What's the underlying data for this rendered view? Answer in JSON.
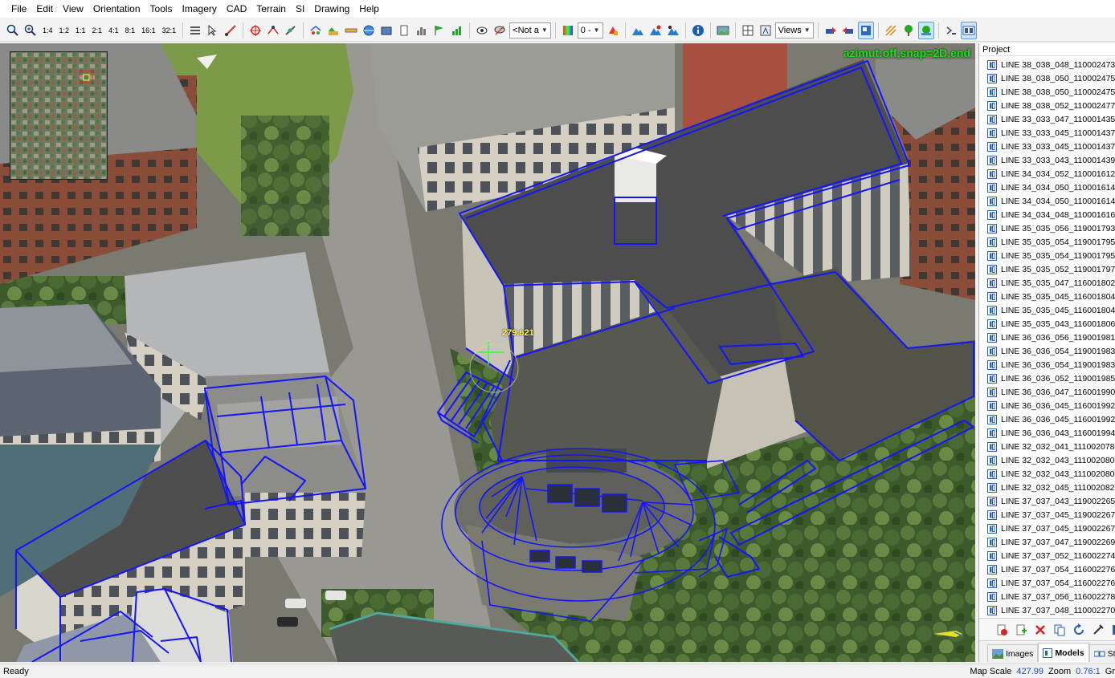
{
  "menu": [
    "File",
    "Edit",
    "View",
    "Orientation",
    "Tools",
    "Imagery",
    "CAD",
    "Terrain",
    "SI",
    "Drawing",
    "Help"
  ],
  "toolbar": {
    "zoom_levels": [
      "1:4",
      "1:2",
      "1:1",
      "2:1",
      "4:1",
      "8:1",
      "16:1",
      "32:1"
    ],
    "combo_not": "<Not a",
    "combo_zero": "0 -",
    "combo_views": "Views"
  },
  "viewport": {
    "overlay_status": "azimut:off,snap=2D,end",
    "height_label": "279.621"
  },
  "project": {
    "title": "Project",
    "items": [
      "LINE 38_038_048_110002473-",
      "LINE 38_038_050_110002475-",
      "LINE 38_038_050_110002475-",
      "LINE 38_038_052_110002477-",
      "LINE 33_033_047_110001435-",
      "LINE 33_033_045_110001437-",
      "LINE 33_033_045_110001437-",
      "LINE 33_033_043_110001439-",
      "LINE 34_034_052_110001612-",
      "LINE 34_034_050_110001614-",
      "LINE 34_034_050_110001614-",
      "LINE 34_034_048_110001616-",
      "LINE 35_035_056_119001793-",
      "LINE 35_035_054_119001795-",
      "LINE 35_035_054_119001795-",
      "LINE 35_035_052_119001797-",
      "LINE 35_035_047_116001802-",
      "LINE 35_035_045_116001804-",
      "LINE 35_035_045_116001804-",
      "LINE 35_035_043_116001806-",
      "LINE 36_036_056_119001981-",
      "LINE 36_036_054_119001983-",
      "LINE 36_036_054_119001983-",
      "LINE 36_036_052_119001985-",
      "LINE 36_036_047_116001990-",
      "LINE 36_036_045_116001992-",
      "LINE 36_036_045_116001992-",
      "LINE 36_036_043_116001994-",
      "LINE 32_032_041_111002078-",
      "LINE 32_032_043_111002080-",
      "LINE 32_032_043_111002080-",
      "LINE 32_032_045_111002082-",
      "LINE 37_037_043_119002265-",
      "LINE 37_037_045_119002267-",
      "LINE 37_037_045_119002267-",
      "LINE 37_037_047_119002269-",
      "LINE 37_037_052_116002274-",
      "LINE 37_037_054_116002276-",
      "LINE 37_037_054_116002276-",
      "LINE 37_037_056_116002278-",
      "LINE 37_037_048_110002270-"
    ],
    "tabs": [
      "Images",
      "Models",
      "St"
    ]
  },
  "statusbar": {
    "ready": "Ready",
    "map_scale_label": "Map Scale",
    "map_scale_value": "427.99",
    "zoom_label": "Zoom",
    "zoom_value": "0.76:1",
    "trailing": "Gr"
  },
  "colors": {
    "model_line": "#1414ff",
    "overlay_text": "#19e619",
    "height_text": "#ffff33",
    "status_value": "#1f4ea8"
  }
}
